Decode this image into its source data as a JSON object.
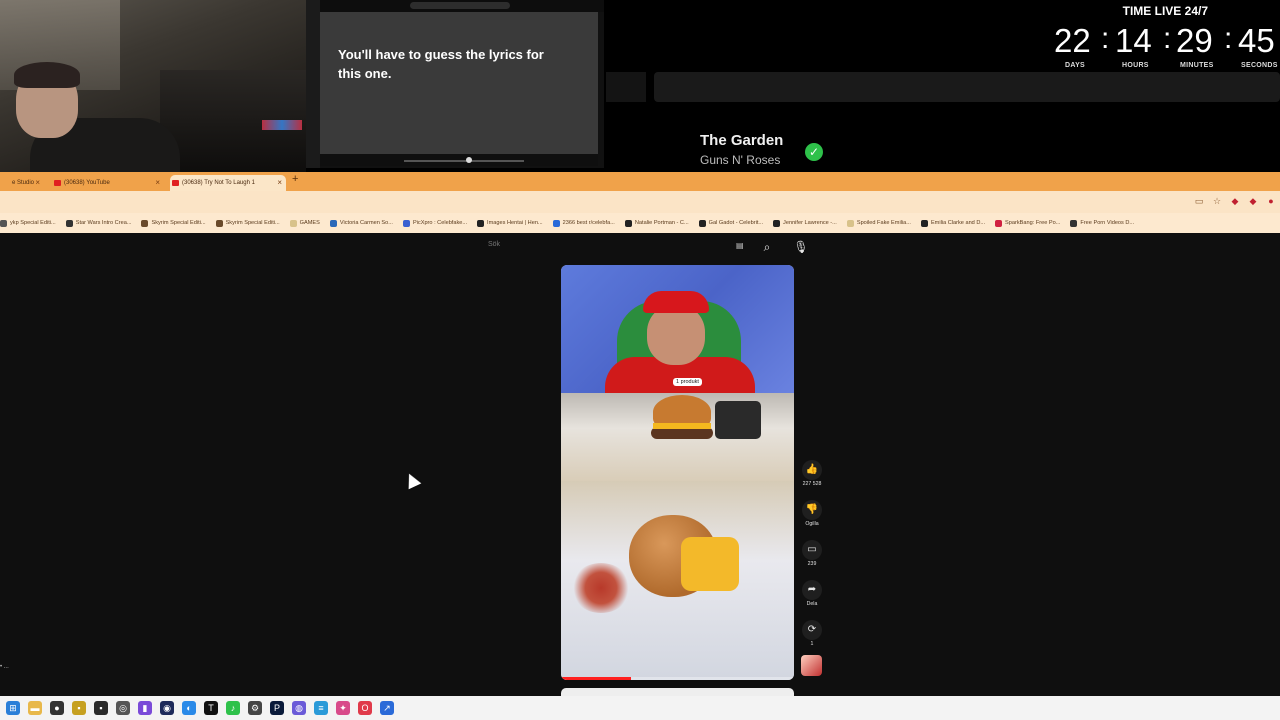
{
  "overlay": {
    "popup_lyric": "You'll have to guess the lyrics for this one.",
    "now_playing": {
      "title": "The Garden",
      "artist": "Guns N' Roses"
    },
    "timer": {
      "heading": "TIME LIVE 24/7",
      "days": "22",
      "hours": "14",
      "minutes": "29",
      "seconds": "45",
      "labels": {
        "days": "DAYS",
        "hours": "HOURS",
        "minutes": "MINUTES",
        "seconds": "SECONDS"
      }
    }
  },
  "browser": {
    "tabs": [
      {
        "label": "e Studio",
        "active": false
      },
      {
        "label": "(30638) YouTube",
        "active": false
      },
      {
        "label": "(30638) Try Not To Laugh 1",
        "active": true
      }
    ],
    "new_tab_label": "+",
    "bookmarks": [
      "ykp Special Editi...",
      "Star Wars Intro Crea...",
      "Skyrim Special Editi...",
      "Skyrim Special Editi...",
      "GAMES",
      "Victoria Carmen So...",
      "PicXpro : Celebfake...",
      "Images Hentai | Hen...",
      "2366 best r/celebfa...",
      "Natalie Portman - C...",
      "Gal Gadot - Celebrit...",
      "Jennifer Lawrence -...",
      "Spoiled Fake Emilia...",
      "Emilia Clarke and D...",
      "SparkBang: Free Po...",
      "Free Porn Videos D..."
    ]
  },
  "youtube": {
    "search_placeholder": "Sök",
    "video_tag": "1 produkt",
    "progress": 0.3,
    "actions": {
      "like_count": "227 528",
      "dislike_label": "Ogilla",
      "comment_count": "239",
      "share_label": "Dela",
      "remix_count": "1"
    }
  },
  "colors": {
    "tabbar": "#f0a24a",
    "toolbar": "#fbe4c6",
    "page_bg": "#0f0f0f",
    "check": "#2ec14a",
    "progress": "#ff2020"
  }
}
